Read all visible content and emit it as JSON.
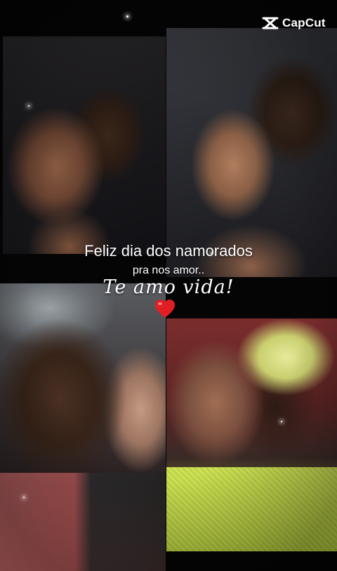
{
  "brand": {
    "logo_text": "CapCut",
    "logo_icon": "capcut-logo-icon"
  },
  "captions": {
    "line1": "Feliz dia dos namorados",
    "line2": "pra nos amor..",
    "line3": "Te amo vida!"
  },
  "decor": {
    "heart_icon": "heart-icon",
    "heart_color": "#e01e24"
  }
}
